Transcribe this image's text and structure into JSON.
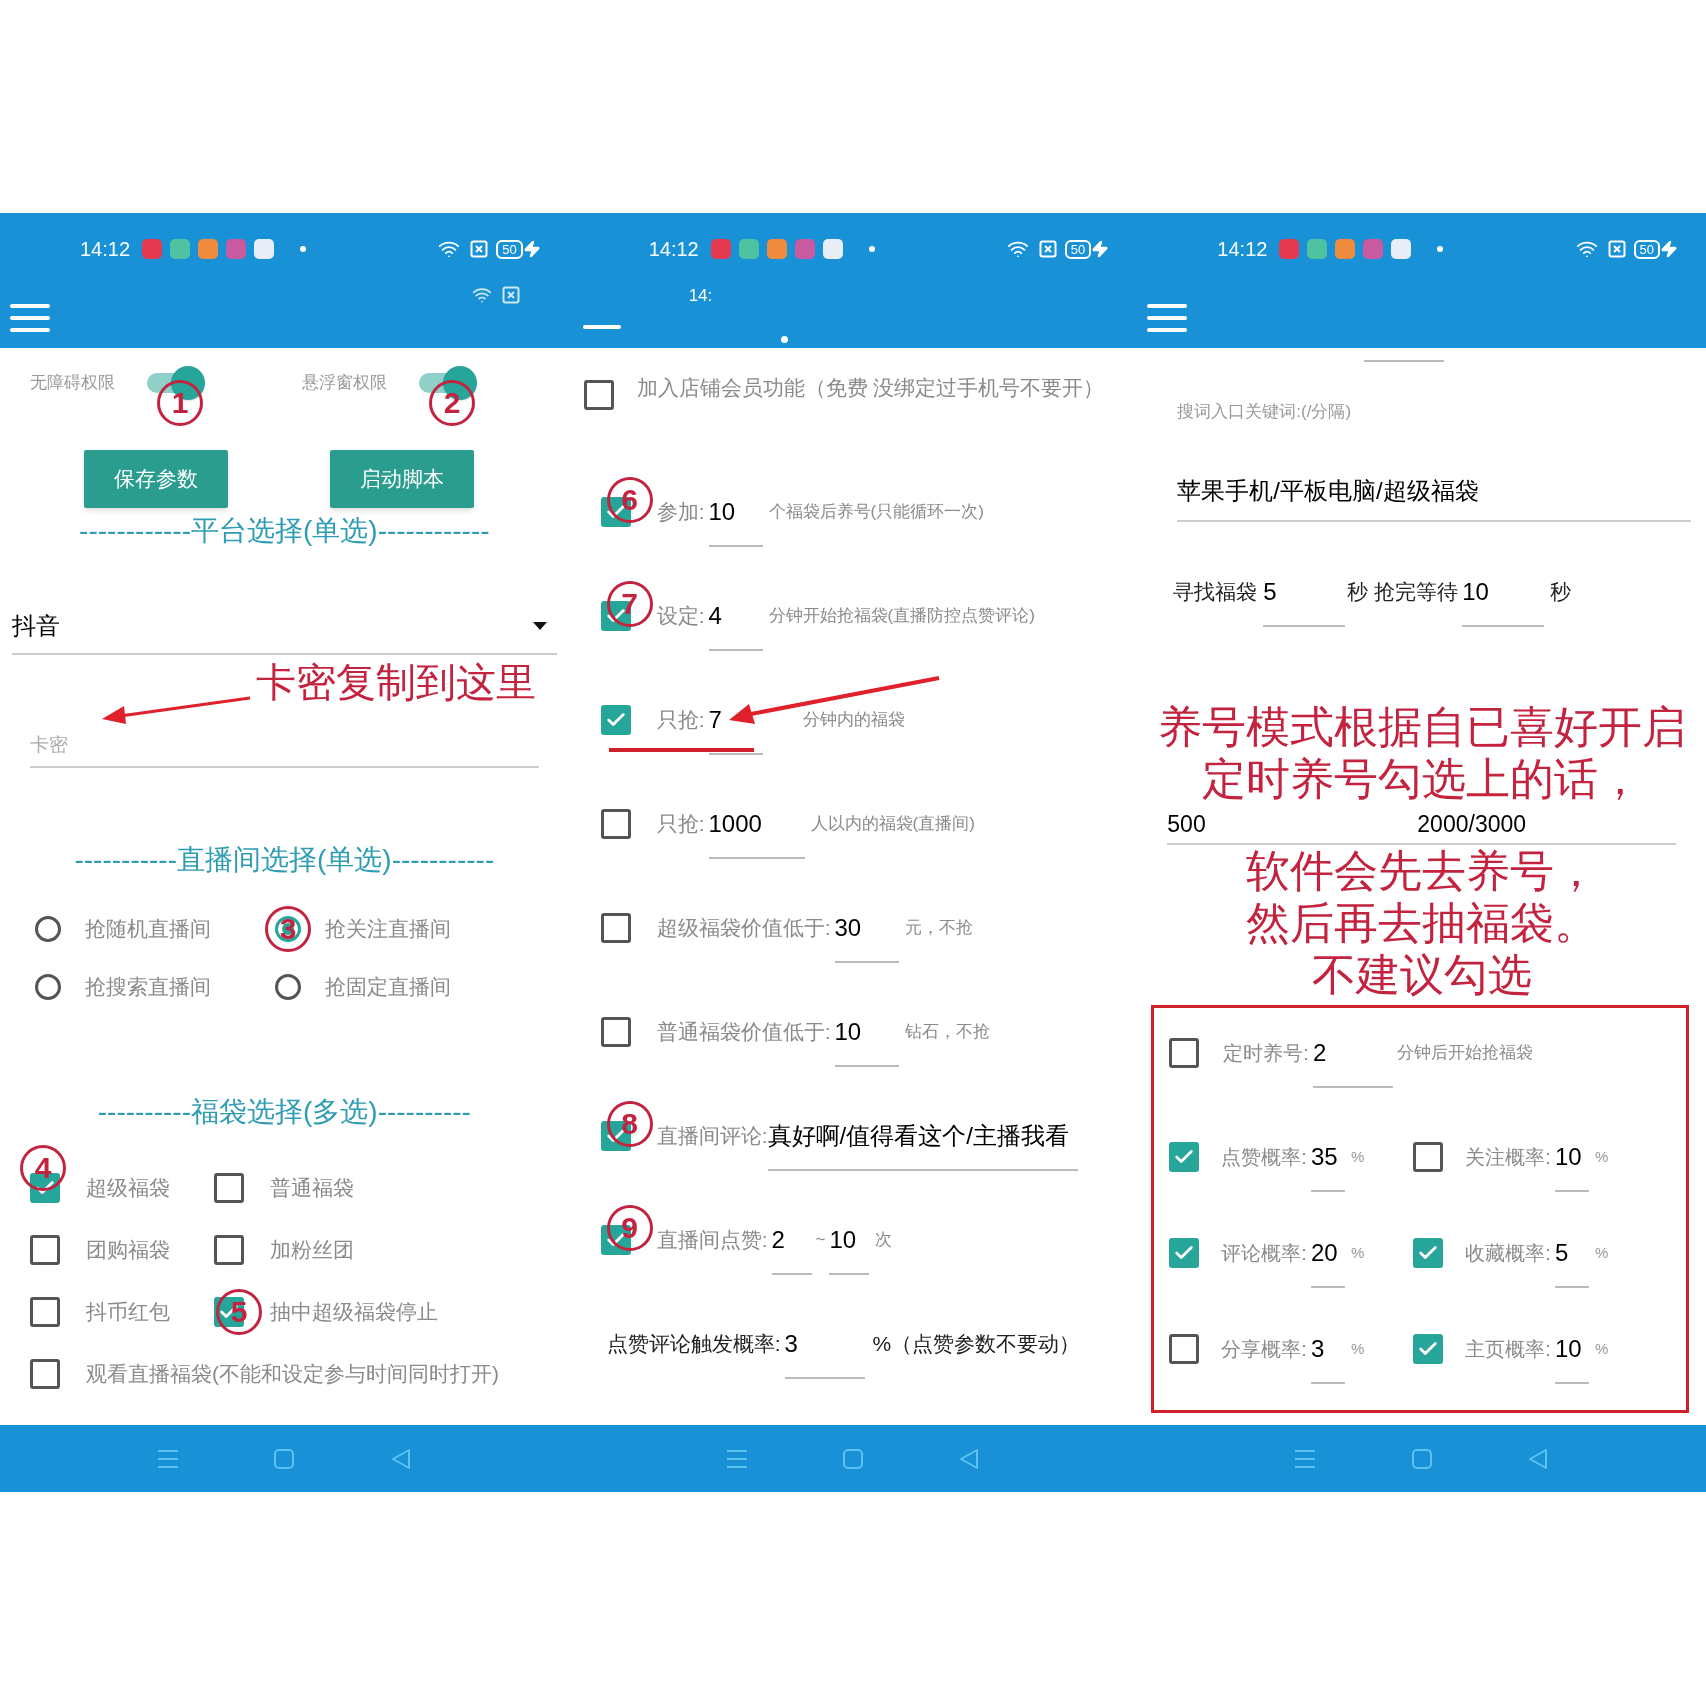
{
  "screen_1": {
    "status_bar": {
      "time": "14:12",
      "battery": "50"
    },
    "app_bar": {
      "kind": "menu",
      "ghost_icons": true
    },
    "permissions": [
      {
        "label": "无障碍权限",
        "on": true,
        "badge": "1"
      },
      {
        "label": "悬浮窗权限",
        "on": true,
        "badge": "2"
      }
    ],
    "buttons": [
      "保存参数",
      "启动脚本"
    ],
    "platform_heading": "------------平台选择(单选)------------",
    "platform_dropdown": {
      "value": "抖音"
    },
    "card_key_field": {
      "placeholder": "卡密",
      "annotation": "卡密复制到这里"
    },
    "room_heading": "-----------直播间选择(单选)-----------",
    "room_options": [
      {
        "label": "抢随机直播间",
        "selected": false
      },
      {
        "label": "抢关注直播间",
        "selected": true,
        "badge": "3"
      },
      {
        "label": "抢搜索直播间",
        "selected": false
      },
      {
        "label": "抢固定直播间",
        "selected": false
      }
    ],
    "bag_heading": "----------福袋选择(多选)----------",
    "bag_options": [
      {
        "label": "超级福袋",
        "checked": true,
        "badge": "4"
      },
      {
        "label": "普通福袋",
        "checked": false
      },
      {
        "label": "团购福袋",
        "checked": false
      },
      {
        "label": "加粉丝团",
        "checked": false
      },
      {
        "label": "抖币红包",
        "checked": false
      },
      {
        "label": "抽中超级福袋停止",
        "checked": true,
        "badge": "5"
      },
      {
        "label": "观看直播福袋(不能和设定参与时间同时打开)",
        "checked": false
      }
    ]
  },
  "screen_2": {
    "status_bar": {
      "time": "14:12",
      "battery": "50"
    },
    "app_bar": {
      "kind": "indicator",
      "ghost_text": "14:"
    },
    "rows": [
      {
        "kind": "checkbox_text",
        "checked": false,
        "label": "加入店铺会员功能（免费 没绑定过手机号不要开）"
      },
      {
        "kind": "checkbox_field",
        "checked": true,
        "badge": "6",
        "label": "参加:",
        "value": "10",
        "suffix": "个福袋后养号(只能循环一次)"
      },
      {
        "kind": "checkbox_field",
        "checked": true,
        "badge": "7",
        "label": "设定:",
        "value": "4",
        "suffix": "分钟开始抢福袋(直播防控点赞评论)"
      },
      {
        "kind": "checkbox_field",
        "checked": true,
        "arrow": true,
        "label": "只抢:",
        "value": "7",
        "suffix": "分钟内的福袋"
      },
      {
        "kind": "checkbox_field",
        "checked": false,
        "label": "只抢:",
        "value": "1000",
        "suffix": "人以内的福袋(直播间)"
      },
      {
        "kind": "checkbox_field",
        "checked": false,
        "label": "超级福袋价值低于:",
        "value": "30",
        "suffix": "元，不抢"
      },
      {
        "kind": "checkbox_field",
        "checked": false,
        "label": "普通福袋价值低于:",
        "value": "10",
        "suffix": "钻石，不抢"
      },
      {
        "kind": "checkbox_wide",
        "checked": true,
        "badge": "8",
        "label": "直播间评论:",
        "value": "真好啊/值得看这个/主播我看"
      },
      {
        "kind": "checkbox_range",
        "checked": true,
        "badge": "9",
        "label": "直播间点赞:",
        "value": "2",
        "separator": "~",
        "value2": "10",
        "suffix": "次"
      },
      {
        "kind": "field",
        "label": "点赞评论触发概率:",
        "value": "3",
        "suffix": "%（点赞参数不要动）"
      }
    ]
  },
  "screen_3": {
    "status_bar": {
      "time": "14:12",
      "battery": "50"
    },
    "app_bar": {
      "kind": "menu"
    },
    "keyword_label": "搜词入口关键词:(/分隔)",
    "keyword_field": {
      "value": "苹果手机/平板电脑/超级福袋"
    },
    "timing": {
      "label": "寻找福袋",
      "value": "5",
      "middle": "秒 抢完等待",
      "value2": "10",
      "unit": "秒"
    },
    "note_lines": [
      "养号模式根据自已喜好开启",
      "定时养号勾选上的话，",
      "软件会先去养号，",
      "然后再去抽福袋。",
      "不建议勾选"
    ],
    "run_values": [
      "500",
      "2000/3000"
    ],
    "schedule": {
      "label": "定时养号:",
      "value": "2",
      "suffix": "分钟后开始抢福袋",
      "checked": false
    },
    "rates": [
      {
        "label": "点赞概率:",
        "value": "35",
        "unit": "%",
        "checked": true
      },
      {
        "label": "关注概率:",
        "value": "10",
        "unit": "%",
        "checked": false
      },
      {
        "label": "评论概率:",
        "value": "20",
        "unit": "%",
        "checked": true
      },
      {
        "label": "收藏概率:",
        "value": "5",
        "unit": "%",
        "checked": true
      },
      {
        "label": "分享概率:",
        "value": "3",
        "unit": "%",
        "checked": false
      },
      {
        "label": "主页概率:",
        "value": "10",
        "unit": "%",
        "checked": true
      }
    ]
  }
}
